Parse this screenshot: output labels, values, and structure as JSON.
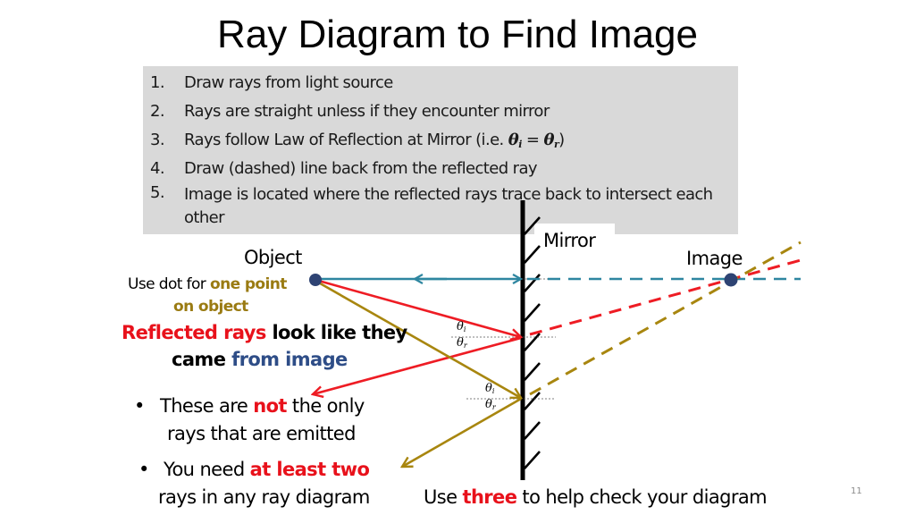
{
  "slide": {
    "title": "Ray Diagram to Find Image",
    "page_number": "11"
  },
  "steps": [
    {
      "num": "1.",
      "text": "Draw rays from light source"
    },
    {
      "num": "2.",
      "text": "Rays are straight unless if they encounter mirror"
    },
    {
      "num": "3.",
      "text_before": "Rays follow Law of Reflection at Mirror (i.e. ",
      "theta": "θ",
      "sub_i": "i",
      "equals": " = ",
      "sub_r": "r",
      "text_after": ")"
    },
    {
      "num": "4.",
      "text": "Draw (dashed) line back from the reflected ray"
    },
    {
      "num": "5.",
      "text": "Image is located where the reflected rays trace back to intersect each other"
    }
  ],
  "labels": {
    "mirror": "Mirror",
    "object": "Object",
    "image": "Image",
    "dot_note": {
      "prefix": "Use dot for ",
      "highlight": "one point",
      "line2": "on object"
    },
    "reflected_note": {
      "red": "Reflected rays",
      "black1": " look like they",
      "black2": "came ",
      "blue": "from image"
    },
    "bullet1": {
      "bullet": "•",
      "before": "These are ",
      "red": "not",
      "after": " the only",
      "line2": "rays that are emitted"
    },
    "bullet2": {
      "bullet": "•",
      "before": "You need ",
      "red": "at least two",
      "line2": "rays in any ray diagram"
    },
    "footer": {
      "before": "Use ",
      "red": "three",
      "after": " to help check your diagram"
    },
    "angle_theta": "θ",
    "angle_i": "i",
    "angle_r": "r"
  },
  "colors": {
    "blue_ray": "#2e86a0",
    "red_ray": "#ee1c24",
    "gold_ray": "#a8860f",
    "dot": "#2e4373",
    "mirror": "#000000",
    "box": "#d9d9d9"
  },
  "diagram": {
    "rays": [
      {
        "name": "horizontal-ray",
        "color_key": "blue_ray",
        "note": "Straight out and back along normal"
      },
      {
        "name": "red-ray",
        "color_key": "red_ray"
      },
      {
        "name": "gold-ray",
        "color_key": "gold_ray"
      }
    ]
  }
}
